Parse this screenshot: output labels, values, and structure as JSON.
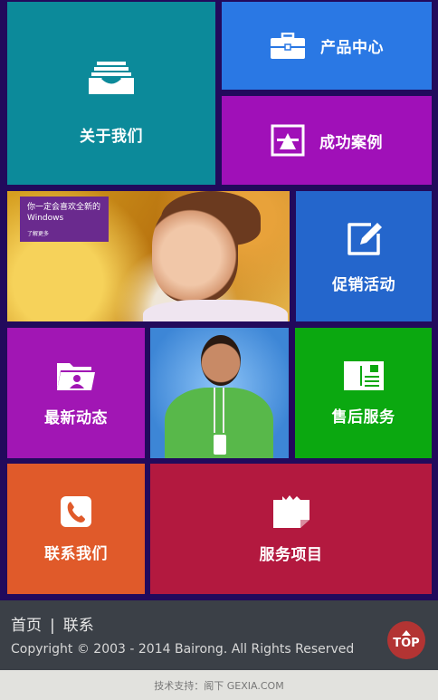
{
  "tiles": {
    "about": {
      "label": "关于我们",
      "icon": "inbox-tray-icon",
      "color": "#0c8a9a"
    },
    "product": {
      "label": "产品中心",
      "icon": "briefcase-icon",
      "color": "#2a78e4"
    },
    "case": {
      "label": "成功案例",
      "icon": "box-crate-icon",
      "color": "#a010b8"
    },
    "promo": {
      "label": "促销活动",
      "icon": "edit-pencil-icon",
      "color": "#2466cc"
    },
    "news": {
      "label": "最新动态",
      "icon": "folder-person-icon",
      "color": "#a116b4"
    },
    "service": {
      "label": "售后服务",
      "icon": "card-icon",
      "color": "#0ba810"
    },
    "contact": {
      "label": "联系我们",
      "icon": "phone-icon",
      "color": "#e05a2a"
    },
    "items": {
      "label": "服务项目",
      "icon": "note-icon",
      "color": "#b3193f"
    }
  },
  "banner": {
    "line1": "你一定会喜欢全新的",
    "line2": "Windows",
    "more": "了解更多"
  },
  "footer": {
    "nav": [
      "首页",
      "联系"
    ],
    "separator": "|",
    "copyright": "Copyright © 2003 - 2014 Bairong. All Rights Reserved",
    "top_label": "TOP",
    "support": "技术支持：阁下 GEXIA.COM"
  },
  "colors": {
    "background": "#220a5c",
    "footer": "#3b4047",
    "top_button": "#b33433"
  }
}
